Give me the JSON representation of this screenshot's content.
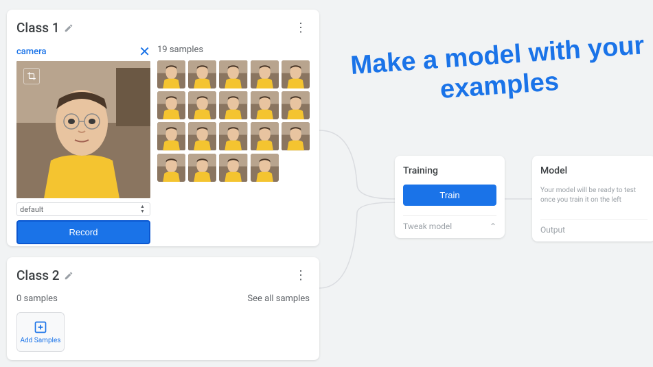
{
  "headline": "Make a model with your examples",
  "class1": {
    "title": "Class 1",
    "camera_label": "camera",
    "default_option": "default",
    "record_label": "Record",
    "samples_count_label": "19 samples",
    "thumb_count": 19
  },
  "class2": {
    "title": "Class 2",
    "samples_label": "0 samples",
    "see_all_label": "See all samples",
    "add_samples_label": "Add Samples"
  },
  "training": {
    "title": "Training",
    "train_label": "Train",
    "tweak_label": "Tweak model"
  },
  "model": {
    "title": "Model",
    "message": "Your model will be ready to test once you train it on the left",
    "output_label": "Output"
  }
}
